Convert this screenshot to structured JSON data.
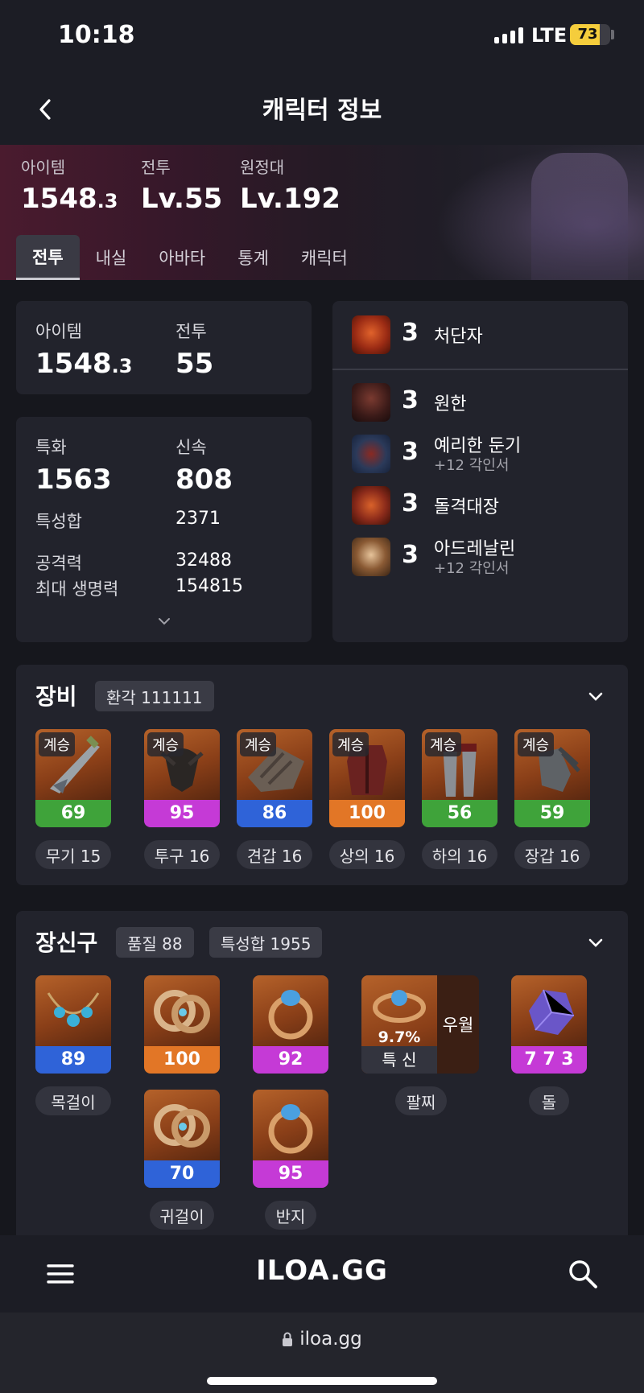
{
  "status_bar": {
    "time": "10:18",
    "network": "LTE",
    "battery": "73",
    "battery_level": 0.73
  },
  "header": {
    "title": "캐릭터 정보"
  },
  "hero": {
    "stats": [
      {
        "label": "아이템",
        "value": "1548",
        "value_small": ".3"
      },
      {
        "label": "전투",
        "value": "Lv.55"
      },
      {
        "label": "원정대",
        "value": "Lv.192"
      }
    ],
    "tabs": [
      "전투",
      "내실",
      "아바타",
      "통계",
      "캐릭터"
    ],
    "active_tab": "전투"
  },
  "summary": {
    "item_label": "아이템",
    "item_value": "1548",
    "item_value_small": ".3",
    "battle_label": "전투",
    "battle_value": "55"
  },
  "stats": {
    "crit_label": "특화",
    "crit_value": "1563",
    "swift_label": "신속",
    "swift_value": "808",
    "total_label": "특성합",
    "total_value": "2371",
    "attack_label": "공격력",
    "attack_value": "32488",
    "hp_label": "최대 생명력",
    "hp_value": "154815"
  },
  "engravings": [
    {
      "level": "3",
      "name": "처단자",
      "sub": "",
      "color": "#b33a1d"
    },
    {
      "level": "3",
      "name": "원한",
      "sub": "",
      "color": "#5a2320"
    },
    {
      "level": "3",
      "name": "예리한 둔기",
      "sub": "+12 각인서",
      "color": "#2b4a6a"
    },
    {
      "level": "3",
      "name": "돌격대장",
      "sub": "",
      "color": "#8b2a1a"
    },
    {
      "level": "3",
      "name": "아드레날린",
      "sub": "+12 각인서",
      "color": "#6b4a2a"
    }
  ],
  "equipment": {
    "title": "장비",
    "chip": "환각 111111",
    "items": [
      {
        "badge": "계승",
        "quality": "69",
        "qcolor": "#3fa33a",
        "label": "무기 15",
        "icon": "weapon-icon"
      },
      {
        "badge": "계승",
        "quality": "95",
        "qcolor": "#c53ad6",
        "label": "투구 16",
        "icon": "helmet-icon"
      },
      {
        "badge": "계승",
        "quality": "86",
        "qcolor": "#2f63d8",
        "label": "견갑 16",
        "icon": "shoulder-icon"
      },
      {
        "badge": "계승",
        "quality": "100",
        "qcolor": "#e27626",
        "label": "상의 16",
        "icon": "chest-icon"
      },
      {
        "badge": "계승",
        "quality": "56",
        "qcolor": "#3fa33a",
        "label": "하의 16",
        "icon": "pants-icon"
      },
      {
        "badge": "계승",
        "quality": "59",
        "qcolor": "#3fa33a",
        "label": "장갑 16",
        "icon": "gloves-icon"
      }
    ]
  },
  "accessories": {
    "title": "장신구",
    "chip1": "품질 88",
    "chip2": "특성합 1955",
    "items": [
      {
        "quality": "89",
        "qcolor": "#2f63d8",
        "label": "목걸이",
        "icon": "necklace-icon"
      },
      {
        "quality": "100",
        "qcolor": "#e27626",
        "label": "",
        "icon": "earring-icon"
      },
      {
        "quality": "92",
        "qcolor": "#c53ad6",
        "label": "",
        "icon": "ring-icon"
      },
      {
        "quality": "70",
        "qcolor": "#2f63d8",
        "label": "귀걸이",
        "icon": "earring-icon"
      },
      {
        "quality": "95",
        "qcolor": "#c53ad6",
        "label": "반지",
        "icon": "ring-icon"
      }
    ],
    "bracelet": {
      "percent": "9.7%",
      "stats": "특 신",
      "grade": "우월",
      "label": "팔찌"
    },
    "stone": {
      "quality": "7 7 3",
      "qcolor": "#c53ad6",
      "label": "돌"
    }
  },
  "bottom_nav": {
    "brand": "ILOA.GG"
  },
  "browser": {
    "url": "iloa.gg"
  }
}
